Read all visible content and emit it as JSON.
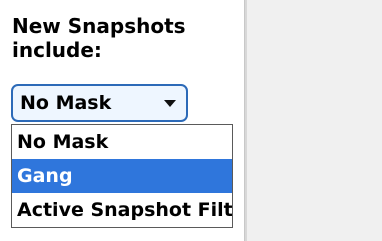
{
  "snapshot_include": {
    "label": "New Snapshots\ninclude:",
    "selected_value": "No Mask",
    "options": [
      {
        "label": "No Mask"
      },
      {
        "label": "Gang"
      },
      {
        "label": "Active Snapshot Filter"
      }
    ],
    "highlighted_option": "Gang"
  },
  "colors": {
    "select_border": "#2c6ab8",
    "select_bg": "#eef6ff",
    "highlight": "#2f76dc",
    "right_panel_bg": "#f0f0f0"
  },
  "icons": {
    "dropdown_arrow": "chevron-down-icon"
  }
}
